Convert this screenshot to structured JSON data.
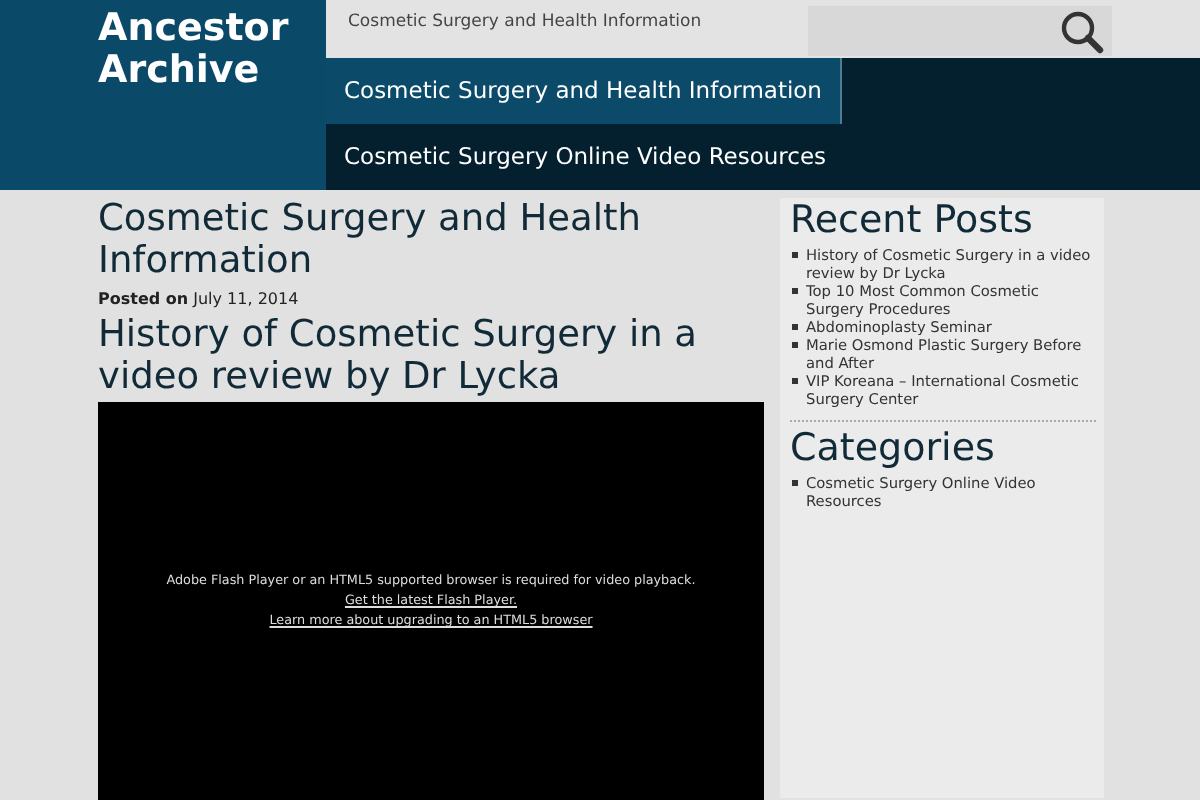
{
  "site": {
    "title": "Ancestor Archive",
    "tagline": "Cosmetic Surgery and Health Information"
  },
  "nav": [
    {
      "label": "Cosmetic Surgery and Health Information",
      "selected": true
    },
    {
      "label": "Cosmetic Surgery Online Video Resources",
      "selected": false
    }
  ],
  "main": {
    "page_title": "Cosmetic Surgery and Health Information",
    "posted": "**Posted on** July 11, 2014",
    "post_title": "History of Cosmetic Surgery in a video review by Dr Lycka",
    "video": {
      "message": "Adobe Flash Player or an HTML5 supported browser is required for video playback.",
      "links": [
        "Get the latest Flash Player.",
        "Learn more about upgrading to an HTML5 browser"
      ]
    }
  },
  "sidebar": [
    {
      "heading": "Recent Posts",
      "items": [
        "History of Cosmetic Surgery in a video review by Dr Lycka",
        "Top 10 Most Common Cosmetic Surgery Procedures",
        "Abdominoplasty Seminar",
        "Marie Osmond Plastic Surgery Before and After",
        "VIP Koreana – International Cosmetic Surgery Center"
      ]
    },
    {
      "heading": "Categories",
      "items": [
        "Cosmetic Surgery Online Video Resources"
      ]
    }
  ]
}
